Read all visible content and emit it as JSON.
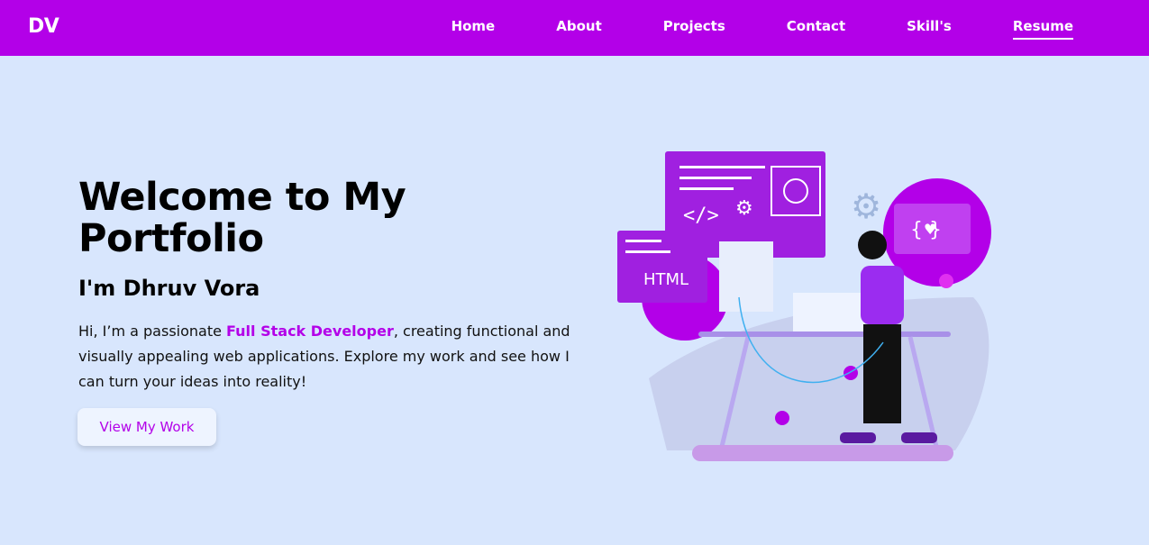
{
  "nav": {
    "logo": "DV",
    "links": [
      {
        "label": "Home"
      },
      {
        "label": "About"
      },
      {
        "label": "Projects"
      },
      {
        "label": "Contact"
      },
      {
        "label": "Skill's"
      },
      {
        "label": "Resume",
        "active": true
      }
    ]
  },
  "hero": {
    "title": "Welcome to My Portfolio",
    "subtitle": "I'm Dhruv Vora",
    "intro_pre": "Hi, I’m a passionate ",
    "intro_highlight": "Full Stack Developer",
    "intro_post": ", creating functional and visually appealing web applications. Explore my work and see how I can turn your ideas into reality!",
    "cta_label": "View My Work"
  },
  "illustration": {
    "html_label": "HTML",
    "code_label": "</>",
    "braces_label": "{ }"
  },
  "colors": {
    "brand": "#b300e8",
    "background": "#d8e6fd"
  }
}
